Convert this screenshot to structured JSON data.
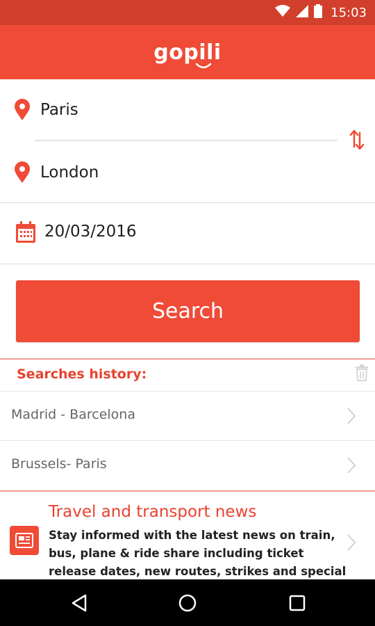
{
  "status_bar": {
    "time": "15:03"
  },
  "app_bar": {
    "logo_text": "gopili"
  },
  "route": {
    "from": "Paris",
    "to": "London"
  },
  "date": {
    "value": "20/03/2016"
  },
  "search": {
    "label": "Search"
  },
  "history": {
    "title": "Searches history:",
    "items": [
      {
        "label": "Madrid - Barcelona"
      },
      {
        "label": "Brussels- Paris"
      }
    ]
  },
  "news": {
    "title": "Travel and transport news",
    "body": "Stay informed with the latest news on train, bus, plane & ride share including ticket release dates, new routes, strikes and special offers."
  },
  "colors": {
    "brand": "#ef4b37",
    "brand_dark": "#d23f2c",
    "nav": "#000000"
  },
  "icons": [
    "wifi-icon",
    "signal-icon",
    "battery-icon",
    "location-pin-icon",
    "swap-icon",
    "calendar-icon",
    "trash-icon",
    "chevron-right-icon",
    "news-icon",
    "back-icon",
    "home-icon",
    "recents-icon"
  ]
}
